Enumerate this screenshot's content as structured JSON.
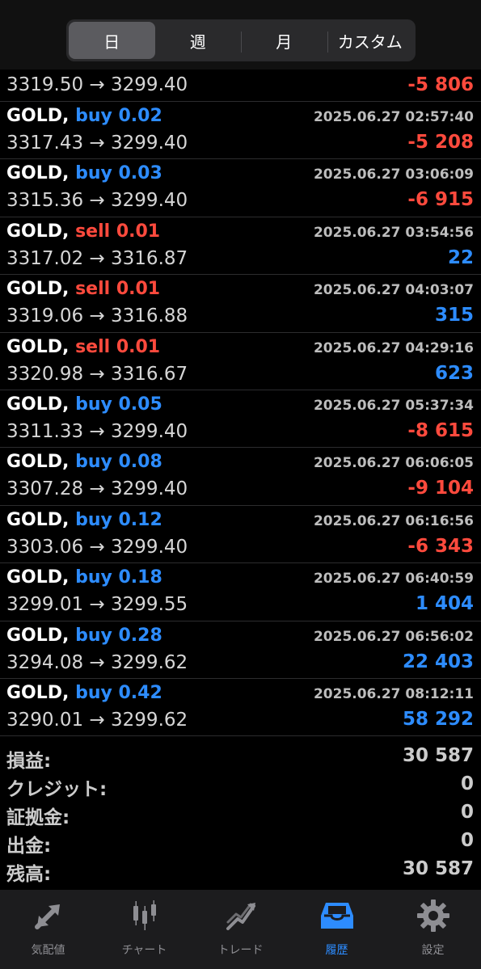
{
  "segments": [
    {
      "label": "日",
      "active": true
    },
    {
      "label": "週",
      "active": false
    },
    {
      "label": "月",
      "active": false
    },
    {
      "label": "カスタム",
      "active": false
    }
  ],
  "partial_row": {
    "open": "3319.50",
    "close": "3299.40",
    "profit": "-5 806"
  },
  "trades": [
    {
      "symbol": "GOLD,",
      "side": "buy 0.02",
      "time": "2025.06.27 02:57:40",
      "open": "3317.43",
      "close": "3299.40",
      "profit": "-5 208",
      "dir": "buy"
    },
    {
      "symbol": "GOLD,",
      "side": "buy 0.03",
      "time": "2025.06.27 03:06:09",
      "open": "3315.36",
      "close": "3299.40",
      "profit": "-6 915",
      "dir": "buy"
    },
    {
      "symbol": "GOLD,",
      "side": "sell 0.01",
      "time": "2025.06.27 03:54:56",
      "open": "3317.02",
      "close": "3316.87",
      "profit": "22",
      "dir": "sell"
    },
    {
      "symbol": "GOLD,",
      "side": "sell 0.01",
      "time": "2025.06.27 04:03:07",
      "open": "3319.06",
      "close": "3316.88",
      "profit": "315",
      "dir": "sell"
    },
    {
      "symbol": "GOLD,",
      "side": "sell 0.01",
      "time": "2025.06.27 04:29:16",
      "open": "3320.98",
      "close": "3316.67",
      "profit": "623",
      "dir": "sell"
    },
    {
      "symbol": "GOLD,",
      "side": "buy 0.05",
      "time": "2025.06.27 05:37:34",
      "open": "3311.33",
      "close": "3299.40",
      "profit": "-8 615",
      "dir": "buy"
    },
    {
      "symbol": "GOLD,",
      "side": "buy 0.08",
      "time": "2025.06.27 06:06:05",
      "open": "3307.28",
      "close": "3299.40",
      "profit": "-9 104",
      "dir": "buy"
    },
    {
      "symbol": "GOLD,",
      "side": "buy 0.12",
      "time": "2025.06.27 06:16:56",
      "open": "3303.06",
      "close": "3299.40",
      "profit": "-6 343",
      "dir": "buy"
    },
    {
      "symbol": "GOLD,",
      "side": "buy 0.18",
      "time": "2025.06.27 06:40:59",
      "open": "3299.01",
      "close": "3299.55",
      "profit": "1 404",
      "dir": "buy"
    },
    {
      "symbol": "GOLD,",
      "side": "buy 0.28",
      "time": "2025.06.27 06:56:02",
      "open": "3294.08",
      "close": "3299.62",
      "profit": "22 403",
      "dir": "buy"
    },
    {
      "symbol": "GOLD,",
      "side": "buy 0.42",
      "time": "2025.06.27 08:12:11",
      "open": "3290.01",
      "close": "3299.62",
      "profit": "58 292",
      "dir": "buy"
    }
  ],
  "arrow": "→",
  "summary": [
    {
      "label": "損益:",
      "value": "30 587"
    },
    {
      "label": "クレジット:",
      "value": "0"
    },
    {
      "label": "証拠金:",
      "value": "0"
    },
    {
      "label": "出金:",
      "value": "0"
    },
    {
      "label": "残高:",
      "value": "30 587"
    }
  ],
  "tabs": [
    {
      "label": "気配値",
      "icon": "quotes-arrows-icon",
      "active": false
    },
    {
      "label": "チャート",
      "icon": "candlestick-chart-icon",
      "active": false
    },
    {
      "label": "トレード",
      "icon": "trade-trend-icon",
      "active": false
    },
    {
      "label": "履歴",
      "icon": "history-inbox-icon",
      "active": true
    },
    {
      "label": "設定",
      "icon": "gear-icon",
      "active": false
    }
  ],
  "colors": {
    "buy": "#2d8cff",
    "sell": "#ff4a3d",
    "active_tab": "#2d8cff"
  }
}
